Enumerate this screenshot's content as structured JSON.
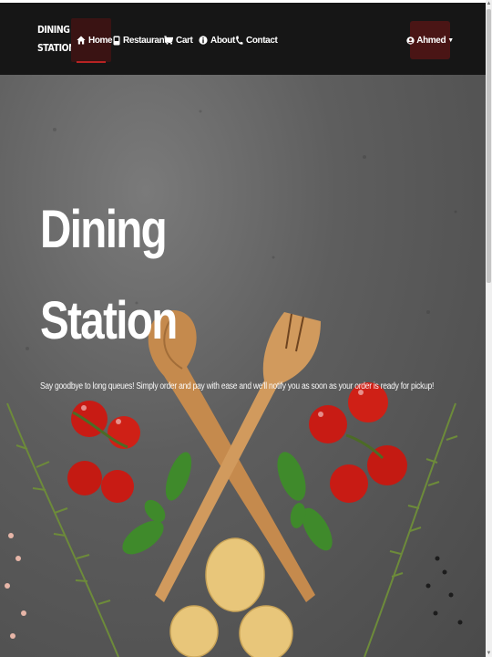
{
  "brand": {
    "line1": "DINING",
    "line2": "STATION"
  },
  "nav": {
    "items": [
      {
        "label": "Home",
        "icon": "home-icon",
        "active": true
      },
      {
        "label": "Restaurants",
        "icon": "restaurant-icon",
        "active": false
      },
      {
        "label": "Cart",
        "icon": "cart-icon",
        "active": false
      },
      {
        "label": "About",
        "icon": "info-icon",
        "active": false
      },
      {
        "label": "Contact",
        "icon": "phone-icon",
        "active": false
      }
    ],
    "user": {
      "label": "Ahmed",
      "icon": "user-icon"
    }
  },
  "hero": {
    "title_line1": "Dining",
    "title_line2": "Station",
    "subtitle": "Say goodbye to long queues! Simply order and pay with ease and we'll notify you as soon as your order is ready for pickup!"
  },
  "colors": {
    "navbar": "#161616",
    "active_tab": "#3a1313",
    "active_underline": "#b72323",
    "user_button": "#4a1515",
    "hero_bg": "#5e5e5e"
  }
}
